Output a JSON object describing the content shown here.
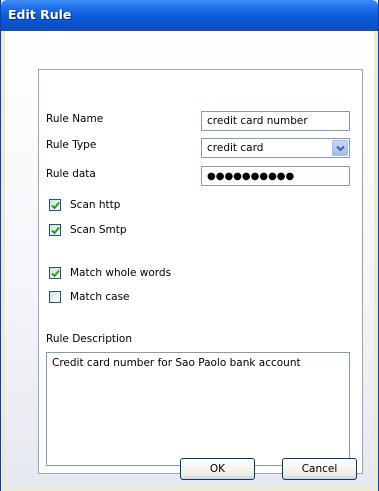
{
  "window": {
    "title": "Edit Rule"
  },
  "form": {
    "rule_name": {
      "label": "Rule Name",
      "value": "credit card number"
    },
    "rule_type": {
      "label": "Rule Type",
      "value": "credit card"
    },
    "rule_data": {
      "label": "Rule data",
      "value": "●●●●●●●●●●"
    },
    "options": [
      {
        "label": "Scan http",
        "checked": true
      },
      {
        "label": "Scan Smtp",
        "checked": true
      },
      {
        "label": "Match whole words",
        "checked": true
      },
      {
        "label": "Match case",
        "checked": false
      }
    ],
    "description": {
      "label": "Rule Description",
      "value": "Credit card number for Sao Paolo bank account"
    }
  },
  "buttons": {
    "ok": "OK",
    "cancel": "Cancel"
  },
  "colors": {
    "title_bar": "#0b5ad8",
    "field_border": "#7f9db9",
    "check_mark": "#21a121"
  },
  "icons": {
    "dropdown": "chevron-down-icon",
    "check": "checkmark-icon"
  }
}
